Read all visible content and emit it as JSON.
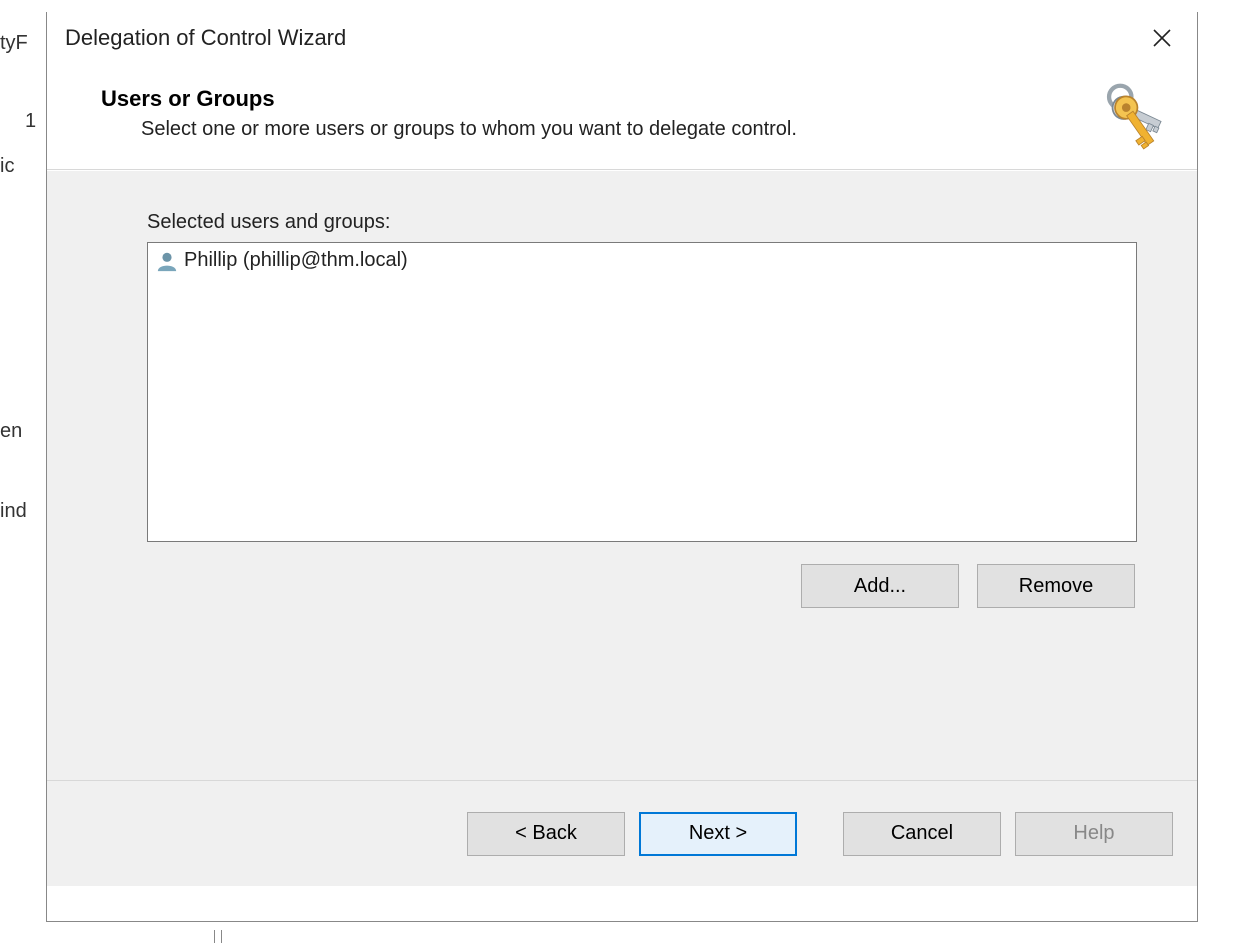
{
  "background_fragments": {
    "tyf": "tyF",
    "one": "1",
    "ic": "ic",
    "en": "en",
    "ind": "ind"
  },
  "dialog": {
    "title": "Delegation of Control Wizard",
    "header": {
      "title": "Users or Groups",
      "description": "Select one or more users or groups to whom you want to delegate control."
    },
    "body": {
      "list_label": "Selected users and groups:",
      "items": [
        {
          "label": "Phillip (phillip@thm.local)"
        }
      ],
      "buttons": {
        "add": "Add...",
        "remove": "Remove"
      }
    },
    "footer": {
      "back": "< Back",
      "next": "Next >",
      "cancel": "Cancel",
      "help": "Help"
    }
  }
}
